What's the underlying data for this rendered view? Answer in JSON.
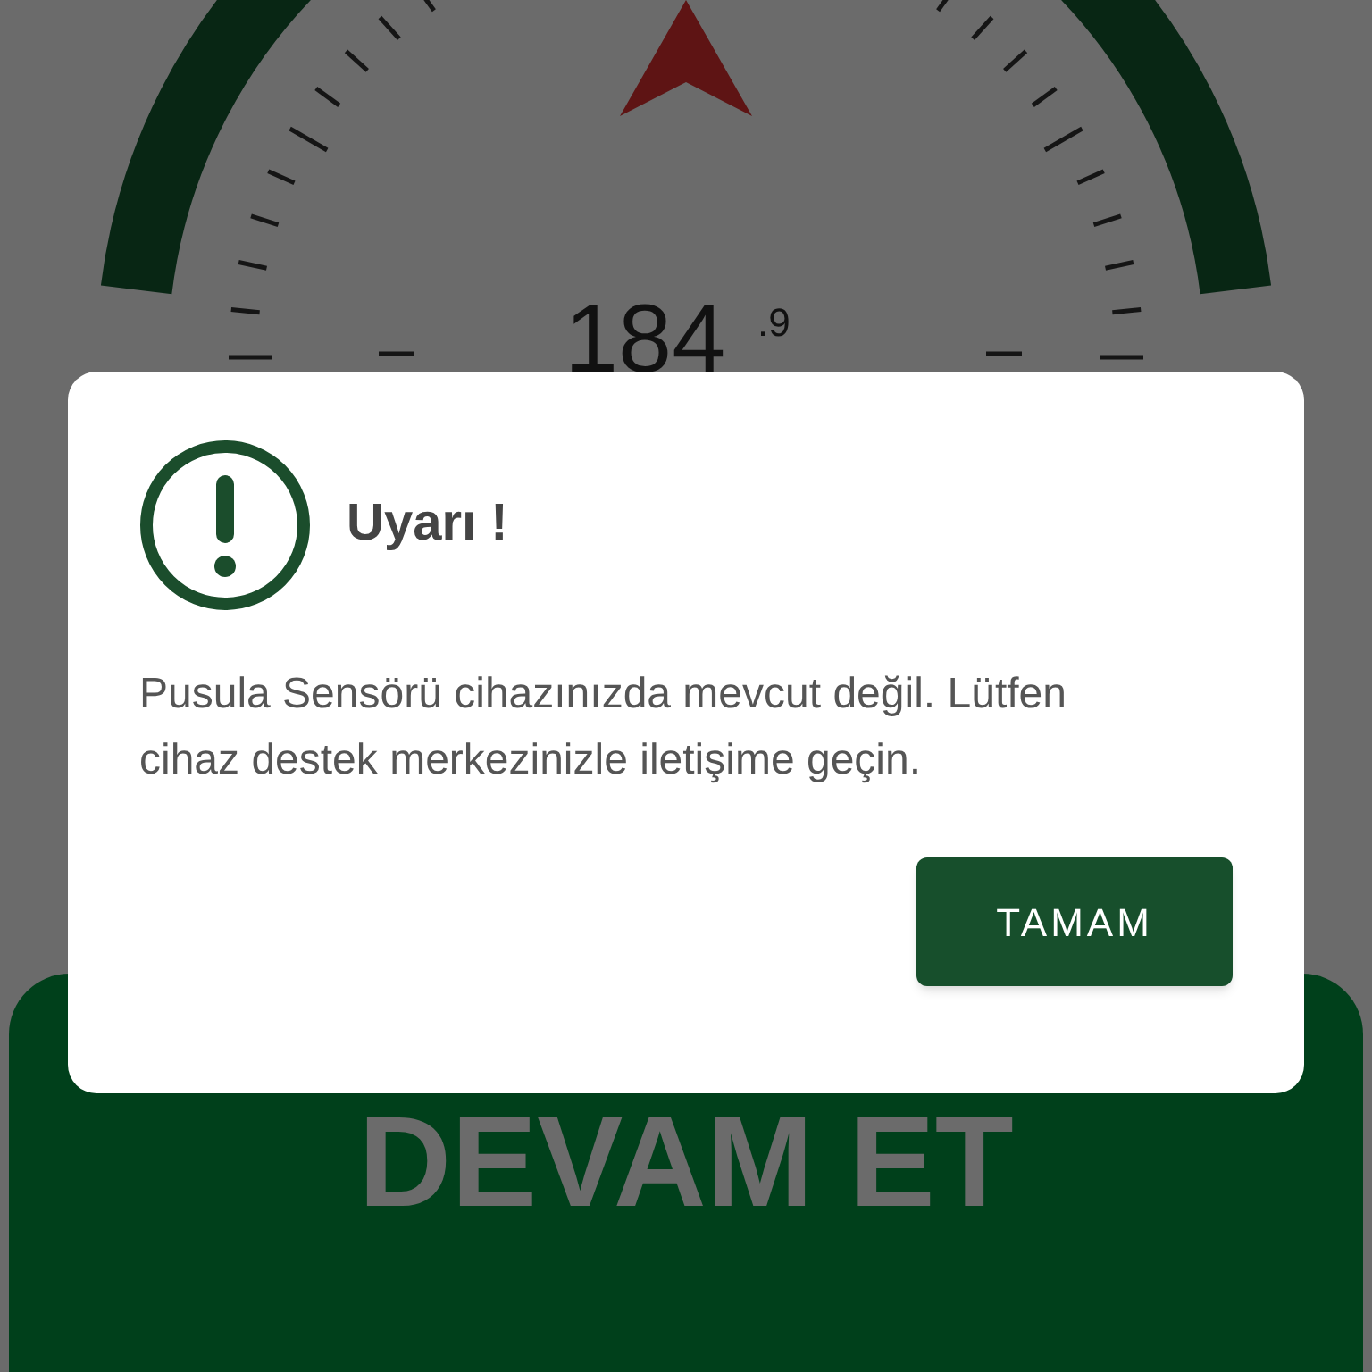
{
  "compass": {
    "heading": "184",
    "decimal": ".9"
  },
  "dialog": {
    "title": "Uyarı !",
    "message": "Pusula Sensörü cihazınızda mevcut değil. Lütfen cihaz destek merkezinizle iletişime geçin.",
    "button": "TAMAM"
  },
  "continue_button": "DEVAM ET"
}
